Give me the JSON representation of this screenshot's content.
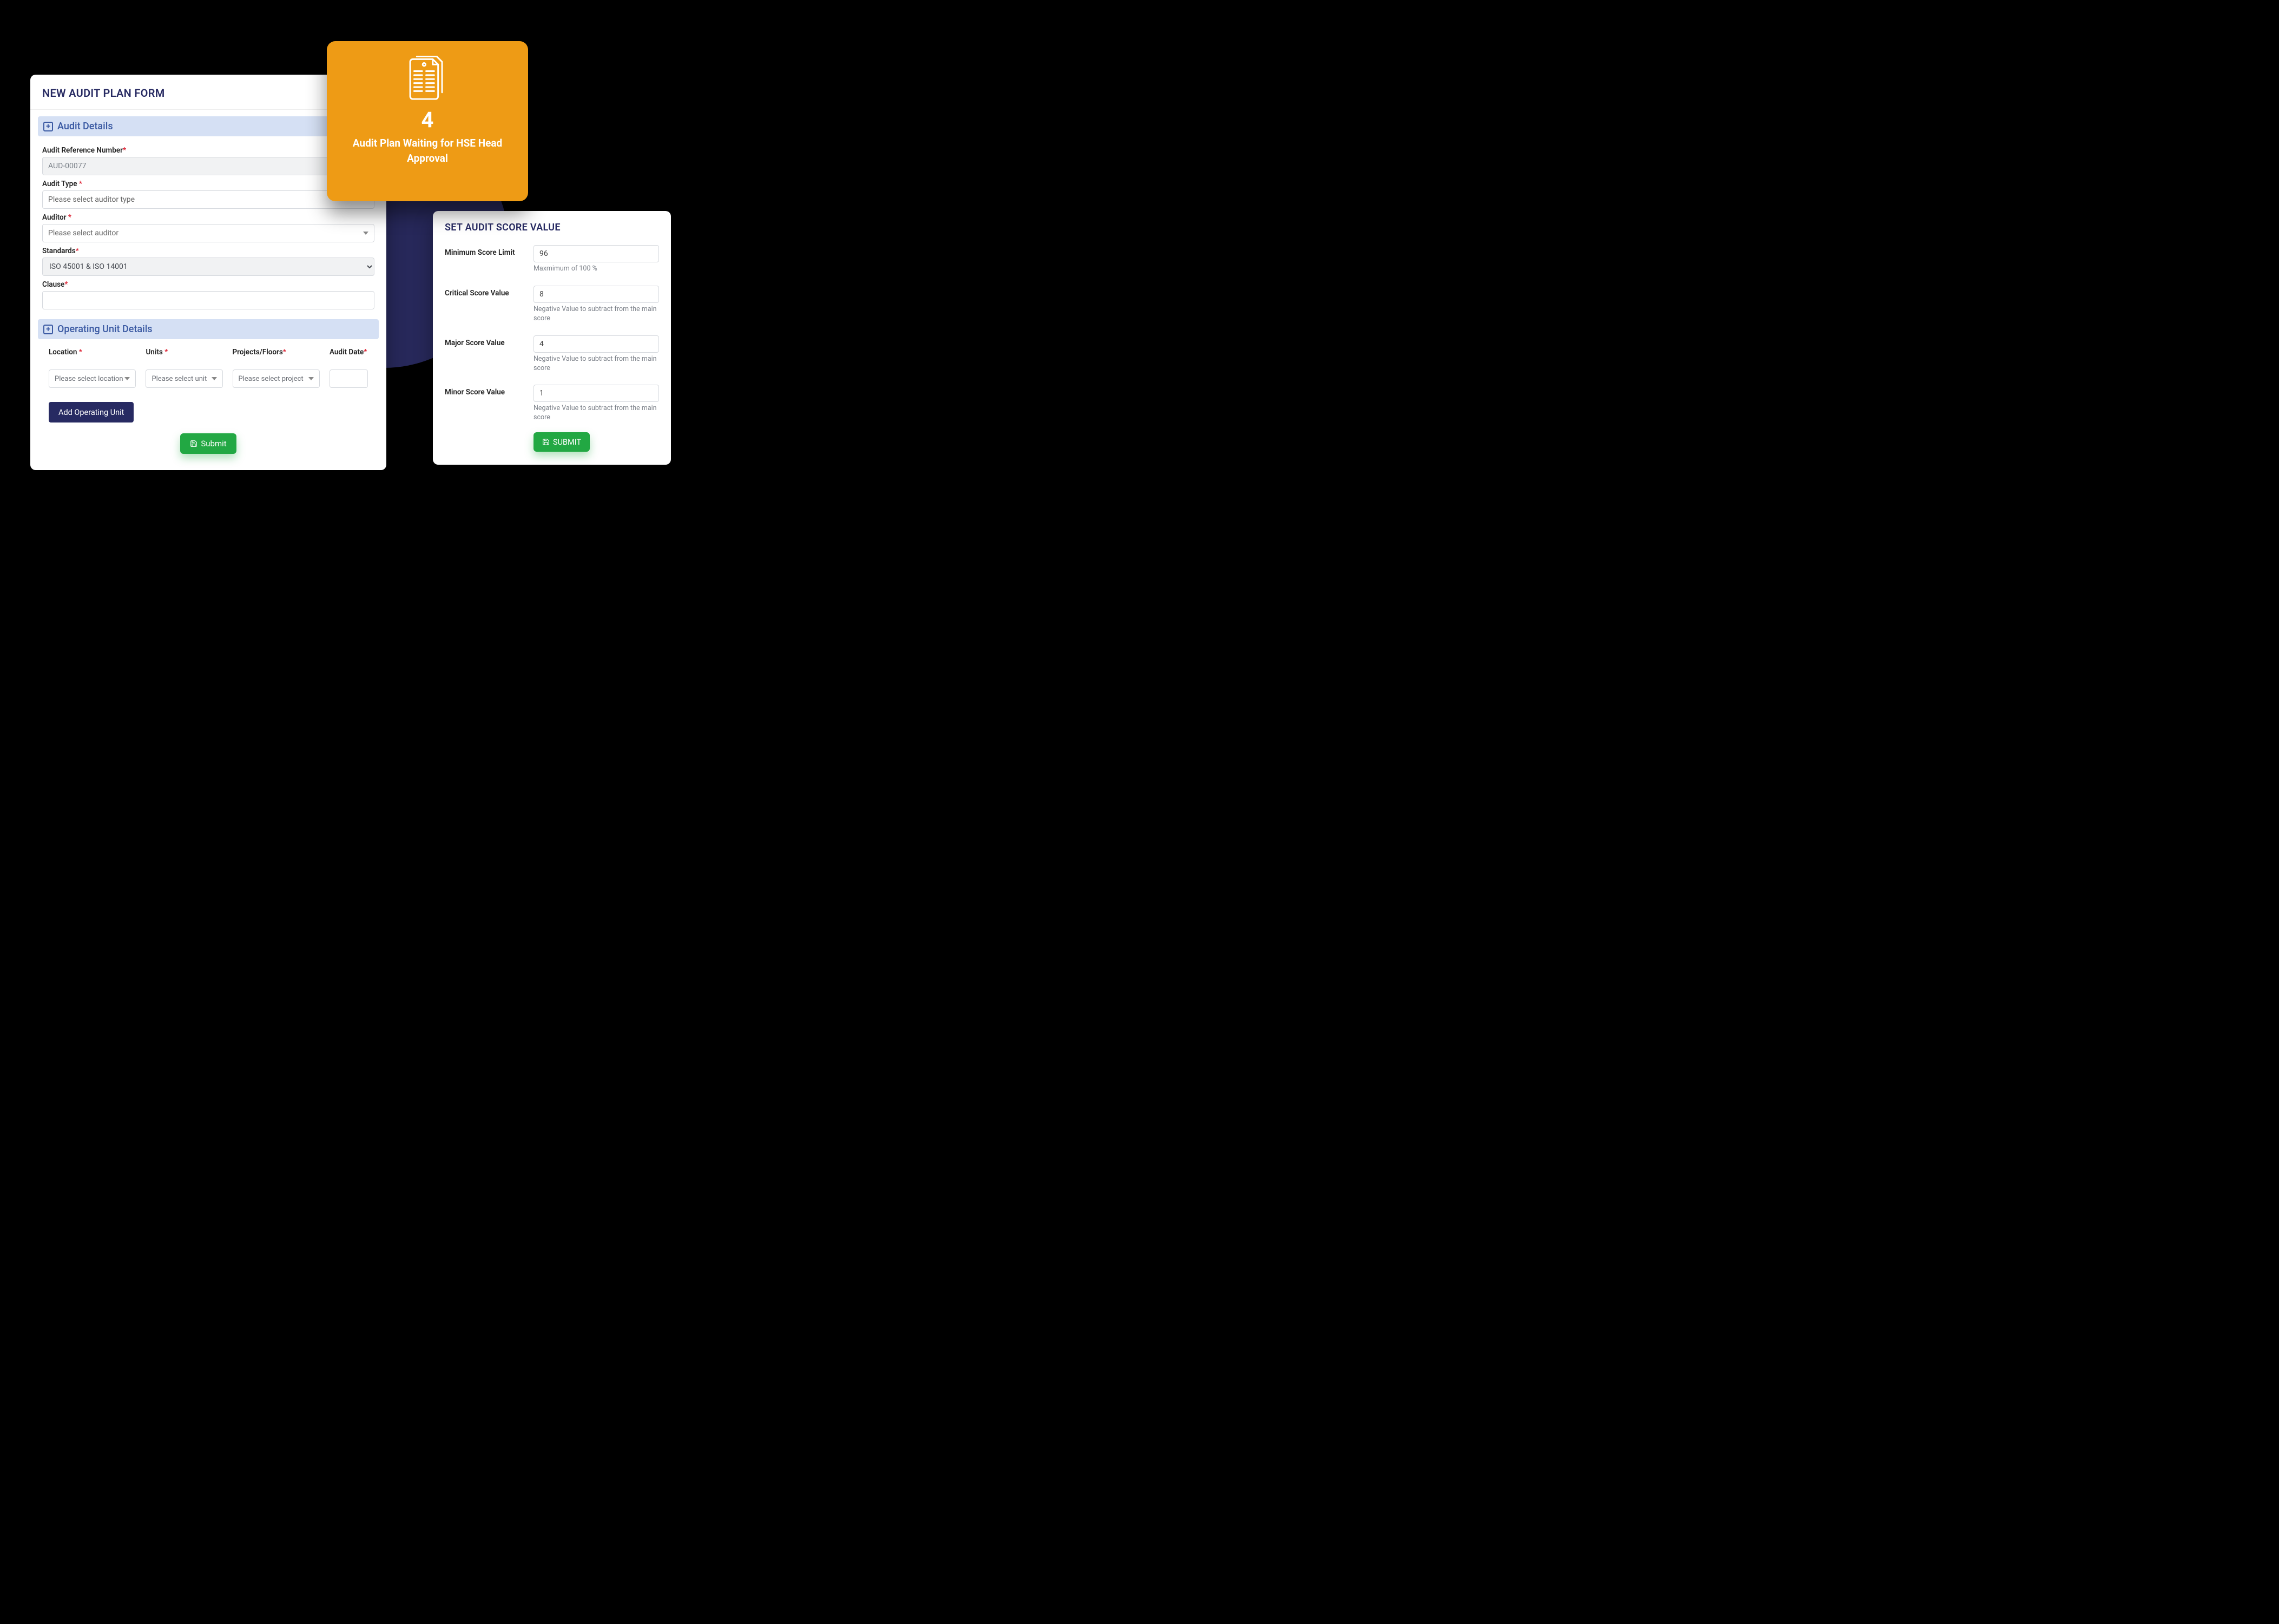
{
  "leftCard": {
    "title": "NEW AUDIT PLAN FORM",
    "section_audit_details": "Audit Details",
    "section_operating_unit_details": "Operating Unit Details",
    "fields": {
      "audit_ref_label": "Audit Reference Number",
      "audit_ref_value": "AUD-00077",
      "audit_type_label": "Audit Type ",
      "audit_type_placeholder": "Please select auditor type",
      "auditor_label": "Auditor ",
      "auditor_placeholder": "Please select auditor",
      "standards_label": "Standards",
      "standards_value": "ISO 45001 & ISO 14001",
      "clause_label": "Clause"
    },
    "ou": {
      "location_label": "Location ",
      "units_label": "Units ",
      "projects_label": "Projects/Floors",
      "audit_date_label": "Audit Date",
      "location_placeholder": "Please select location",
      "units_placeholder": "Please select unit",
      "projects_placeholder": "Please select project"
    },
    "btn_add_unit": "Add Operating Unit",
    "btn_submit": "Submit"
  },
  "orangeCard": {
    "count": "4",
    "text": "Audit Plan Waiting for HSE Head Approval"
  },
  "rightCard": {
    "title": "SET AUDIT SCORE VALUE",
    "rows": {
      "min_label": "Minimum Score Limit",
      "min_value": "96",
      "min_hint": "Maxmimum of 100 %",
      "crit_label": "Critical Score Value",
      "crit_value": "8",
      "crit_hint": "Negative Value to subtract from the main score",
      "major_label": "Major Score Value",
      "major_value": "4",
      "major_hint": "Negative Value to subtract from the main score",
      "minor_label": "Minor Score Value",
      "minor_value": "1",
      "minor_hint": "Negative Value to subtract from the main score"
    },
    "btn_submit": "SUBMIT"
  },
  "required_mark": "*"
}
